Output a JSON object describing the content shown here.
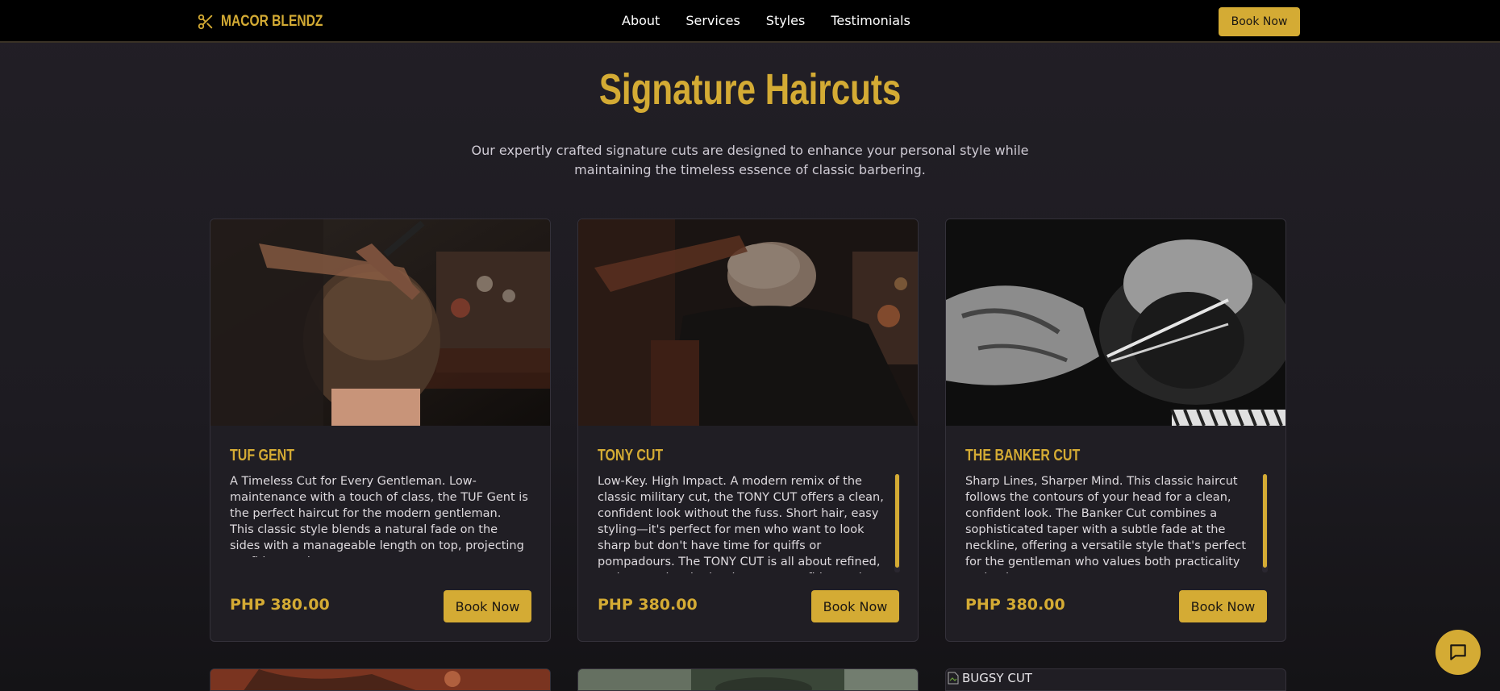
{
  "brand": {
    "name": "MACOR BLENDZ",
    "icon": "scissors-icon"
  },
  "nav": {
    "links": [
      "About",
      "Services",
      "Styles",
      "Testimonials"
    ],
    "cta": "Book Now"
  },
  "section": {
    "title": "Signature Haircuts",
    "subtitle": "Our expertly crafted signature cuts are designed to enhance your personal style while maintaining the timeless essence of classic barbering."
  },
  "cards": [
    {
      "title": "TUF GENT",
      "description": "A Timeless Cut for Every Gentleman. Low-maintenance with a touch of class, the TUF Gent is the perfect haircut for the modern gentleman. This classic style blends a natural fade on the sides with a manageable length on top, projecting confidence wherever you go.",
      "price": "PHP 380.00",
      "button": "Book Now"
    },
    {
      "title": "TONY CUT",
      "description": "Low-Key. High Impact. A modern remix of the classic military cut, the TONY CUT offers a clean, confident look without the fuss. Short hair, easy styling—it's perfect for men who want to look sharp but don't have time for quiffs or pompadours. The TONY CUT is all about refined, understated style that lets your confidence do the talking.",
      "price": "PHP 380.00",
      "button": "Book Now"
    },
    {
      "title": "THE BANKER CUT",
      "description": "Sharp Lines, Sharper Mind. This classic haircut follows the contours of your head for a clean, confident look. The Banker Cut combines a sophisticated taper with a subtle fade at the neckline, offering a versatile style that's perfect for the gentleman who values both practicality and poise.",
      "price": "PHP 380.00",
      "button": "Book Now"
    }
  ],
  "next_row": {
    "broken_image_alt": "BUGSY CUT"
  },
  "colors": {
    "accent": "#d4ab34",
    "background": "#1f1d23",
    "card": "#201e24"
  },
  "chat": {
    "icon": "chat-bubble-icon"
  }
}
